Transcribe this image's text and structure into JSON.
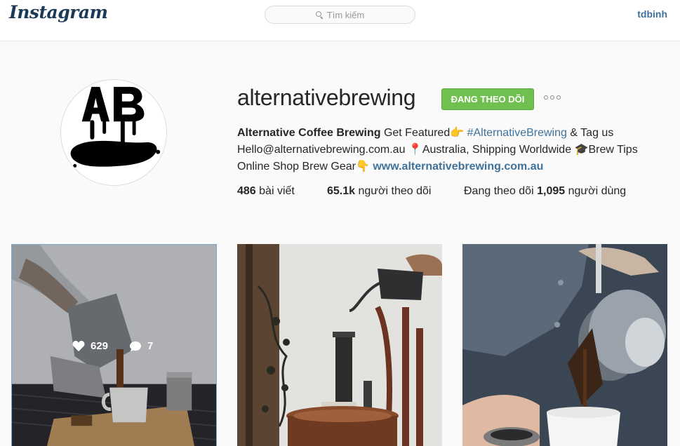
{
  "header": {
    "logo_text": "Instagram",
    "search": {
      "placeholder": "Tìm kiếm",
      "icon": "search-icon"
    },
    "username": "tdbinh"
  },
  "profile": {
    "username": "alternativebrewing",
    "follow_button": "ĐANG THEO DÕI",
    "more_icon": "more-dots-icon",
    "bio": {
      "full_name": "Alternative Coffee Brewing",
      "line1_text": "Get Featured👉",
      "hashtag": "#AlternativeBrewing",
      "line1_tail": "& Tag us",
      "line2": "Hello@alternativebrewing.com.au 📍Australia, Shipping Worldwide 🎓Brew Tips",
      "line3_text": "Online Shop Brew Gear👇",
      "website": "www.alternativebrewing.com.au"
    },
    "stats": {
      "posts_count": "486",
      "posts_label": "bài viết",
      "followers_count": "65.1k",
      "followers_label": "người theo dõi",
      "following_prefix": "Đang theo dõi",
      "following_count": "1,095",
      "following_label": "người dùng"
    }
  },
  "posts": [
    {
      "likes": "629",
      "comments": "7",
      "hovered": true
    },
    {
      "hovered": false
    },
    {
      "hovered": false
    }
  ],
  "colors": {
    "follow_green": "#70c050",
    "link_blue": "#3f729b"
  }
}
